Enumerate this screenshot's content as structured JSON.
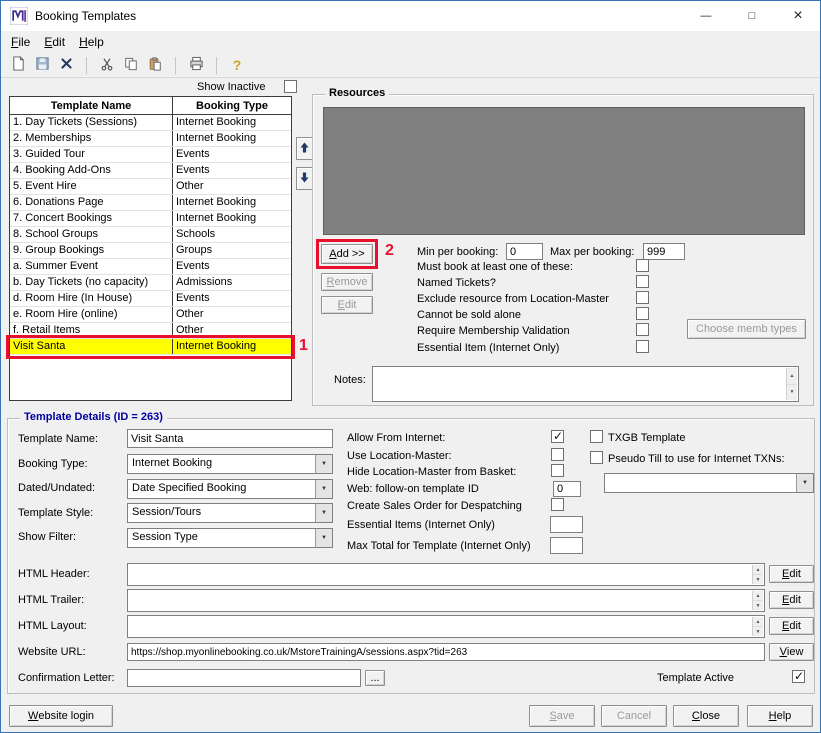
{
  "window": {
    "title": "Booking Templates",
    "minimize_glyph": "—",
    "maximize_glyph": "□",
    "close_glyph": "×"
  },
  "menu": {
    "file": "File",
    "edit": "Edit",
    "help": "Help"
  },
  "topbar": {
    "show_inactive_label": "Show Inactive",
    "show_inactive_checked": false
  },
  "table": {
    "headers": {
      "name": "Template Name",
      "type": "Booking Type"
    },
    "rows": [
      {
        "name": "1. Day Tickets (Sessions)",
        "type": "Internet Booking"
      },
      {
        "name": "2. Memberships",
        "type": "Internet Booking"
      },
      {
        "name": "3. Guided Tour",
        "type": "Events"
      },
      {
        "name": "4. Booking Add-Ons",
        "type": "Events"
      },
      {
        "name": "5. Event Hire",
        "type": "Other"
      },
      {
        "name": "6. Donations Page",
        "type": "Internet Booking"
      },
      {
        "name": "7. Concert Bookings",
        "type": "Internet Booking"
      },
      {
        "name": "8. School Groups",
        "type": "Schools"
      },
      {
        "name": "9. Group Bookings",
        "type": "Groups"
      },
      {
        "name": "a. Summer Event",
        "type": "Events"
      },
      {
        "name": "b. Day Tickets (no capacity)",
        "type": "Admissions"
      },
      {
        "name": "d. Room Hire (In House)",
        "type": "Events"
      },
      {
        "name": "e. Room Hire (online)",
        "type": "Other"
      },
      {
        "name": "f. Retail Items",
        "type": "Other"
      },
      {
        "name": "Visit Santa",
        "type": "Internet Booking"
      }
    ]
  },
  "annotations": {
    "one": "1",
    "two": "2"
  },
  "resources": {
    "title": "Resources",
    "add": "Add >>",
    "remove": "Remove",
    "edit": "Edit",
    "min_label": "Min per booking:",
    "min_value": "0",
    "max_label": "Max per booking:",
    "max_value": "999",
    "check_labels": [
      "Must book at least one of these:",
      "Named Tickets?",
      "Exclude resource from Location-Master",
      "Cannot be sold alone",
      "Require Membership Validation",
      "Essential Item (Internet Only)"
    ],
    "check_states": [
      false,
      false,
      false,
      false,
      false,
      false
    ],
    "choose_memb": "Choose memb types",
    "notes_label": "Notes:"
  },
  "details": {
    "title": "Template Details (ID = 263)",
    "template_name": {
      "label": "Template Name:",
      "value": "Visit Santa"
    },
    "booking_type": {
      "label": "Booking Type:",
      "value": "Internet Booking"
    },
    "dated": {
      "label": "Dated/Undated:",
      "value": "Date Specified Booking"
    },
    "style": {
      "label": "Template Style:",
      "value": "Session/Tours"
    },
    "filter": {
      "label": "Show Filter:",
      "value": "Session Type"
    },
    "allow_internet": {
      "label": "Allow From Internet:",
      "checked": true
    },
    "use_location": {
      "label": "Use Location-Master:",
      "checked": false
    },
    "hide_location": {
      "label": "Hide Location-Master from Basket:",
      "checked": false
    },
    "web_follow": {
      "label": "Web: follow-on template ID",
      "value": "0"
    },
    "create_sales": {
      "label": "Create Sales Order for Despatching",
      "checked": false
    },
    "essential_items": {
      "label": "Essential Items (Internet Only)",
      "value": ""
    },
    "max_total": {
      "label": "Max Total for Template (Internet Only)",
      "value": ""
    },
    "txgb": {
      "label": "TXGB Template",
      "checked": false
    },
    "pseudo_till": {
      "label": "Pseudo Till to use for Internet TXNs:",
      "checked": false,
      "value": ""
    },
    "html_header": {
      "label": "HTML Header:",
      "value": "",
      "button": "Edit"
    },
    "html_trailer": {
      "label": "HTML Trailer:",
      "value": "",
      "button": "Edit"
    },
    "html_layout": {
      "label": "HTML Layout:",
      "value": "",
      "button": "Edit"
    },
    "website_url": {
      "label": "Website URL:",
      "value": "https://shop.myonlinebooking.co.uk/MstoreTrainingA/sessions.aspx?tid=263",
      "button": "View"
    },
    "confirmation": {
      "label": "Confirmation Letter:",
      "value": "",
      "button": "..."
    },
    "template_active": {
      "label": "Template Active",
      "checked": true
    }
  },
  "footer": {
    "website_login": "Website login",
    "save": "Save",
    "cancel": "Cancel",
    "close": "Close",
    "help": "Help"
  },
  "colors": {
    "highlight_row": "#ffff00",
    "annotation_red": "#e8112d",
    "details_title": "#0000a0",
    "resources_list_bg": "#808080"
  }
}
